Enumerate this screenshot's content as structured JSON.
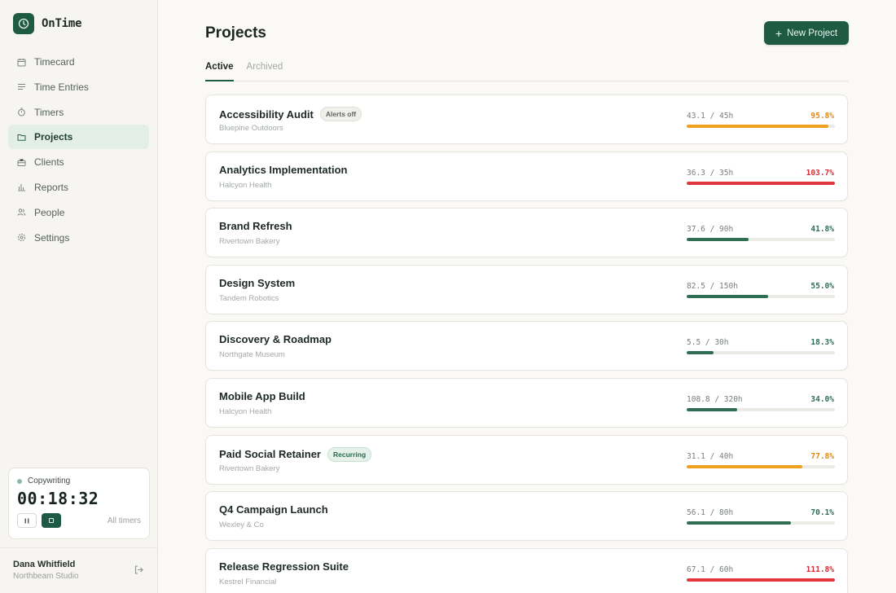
{
  "app": {
    "name": "OnTime"
  },
  "sidebar": {
    "items": [
      {
        "label": "Timecard",
        "icon": "calendar-icon",
        "active": false
      },
      {
        "label": "Time Entries",
        "icon": "list-icon",
        "active": false
      },
      {
        "label": "Timers",
        "icon": "stopwatch-icon",
        "active": false
      },
      {
        "label": "Projects",
        "icon": "folder-icon",
        "active": true
      },
      {
        "label": "Clients",
        "icon": "briefcase-icon",
        "active": false
      },
      {
        "label": "Reports",
        "icon": "bar-chart-icon",
        "active": false
      },
      {
        "label": "People",
        "icon": "people-icon",
        "active": false
      },
      {
        "label": "Settings",
        "icon": "gear-icon",
        "active": false
      }
    ],
    "timer": {
      "task": "Copywriting",
      "time": "00:18:32",
      "all_label": "All timers"
    },
    "user": {
      "name": "Dana Whitfield",
      "org": "Northbeam Studio"
    }
  },
  "main": {
    "title": "Projects",
    "new_button": "New Project",
    "tabs": [
      {
        "label": "Active",
        "active": true
      },
      {
        "label": "Archived",
        "active": false
      }
    ],
    "projects": [
      {
        "name": "Accessibility Audit",
        "badge": "Alerts off",
        "badge_style": "neutral",
        "client": "Bluepine Outdoors",
        "hours": "43.1 / 45h",
        "pct": "95.8%",
        "progress": 0.958,
        "status": "warn"
      },
      {
        "name": "Analytics Implementation",
        "badge": "",
        "badge_style": "",
        "client": "Halcyon Health",
        "hours": "36.3 / 35h",
        "pct": "103.7%",
        "progress": 1.0,
        "status": "over"
      },
      {
        "name": "Brand Refresh",
        "badge": "",
        "badge_style": "",
        "client": "Rivertown Bakery",
        "hours": "37.6 / 90h",
        "pct": "41.8%",
        "progress": 0.418,
        "status": "ok"
      },
      {
        "name": "Design System",
        "badge": "",
        "badge_style": "",
        "client": "Tandem Robotics",
        "hours": "82.5 / 150h",
        "pct": "55.0%",
        "progress": 0.55,
        "status": "ok"
      },
      {
        "name": "Discovery & Roadmap",
        "badge": "",
        "badge_style": "",
        "client": "Northgate Museum",
        "hours": "5.5 / 30h",
        "pct": "18.3%",
        "progress": 0.183,
        "status": "ok"
      },
      {
        "name": "Mobile App Build",
        "badge": "",
        "badge_style": "",
        "client": "Halcyon Health",
        "hours": "108.8 / 320h",
        "pct": "34.0%",
        "progress": 0.34,
        "status": "ok"
      },
      {
        "name": "Paid Social Retainer",
        "badge": "Recurring",
        "badge_style": "green",
        "client": "Rivertown Bakery",
        "hours": "31.1 / 40h",
        "pct": "77.8%",
        "progress": 0.778,
        "status": "warn"
      },
      {
        "name": "Q4 Campaign Launch",
        "badge": "",
        "badge_style": "",
        "client": "Wexley & Co",
        "hours": "56.1 / 80h",
        "pct": "70.1%",
        "progress": 0.701,
        "status": "ok"
      },
      {
        "name": "Release Regression Suite",
        "badge": "",
        "badge_style": "",
        "client": "Kestrel Financial",
        "hours": "67.1 / 60h",
        "pct": "111.8%",
        "progress": 1.0,
        "status": "over"
      }
    ]
  },
  "colors": {
    "accent": "#1f5a45",
    "ok_bar": "#2f6e55",
    "ok_text": "#2f6e55",
    "warn_bar": "#f0a21e",
    "warn_text": "#e08a10",
    "over_bar": "#e0373f",
    "over_text": "#d92d36"
  }
}
